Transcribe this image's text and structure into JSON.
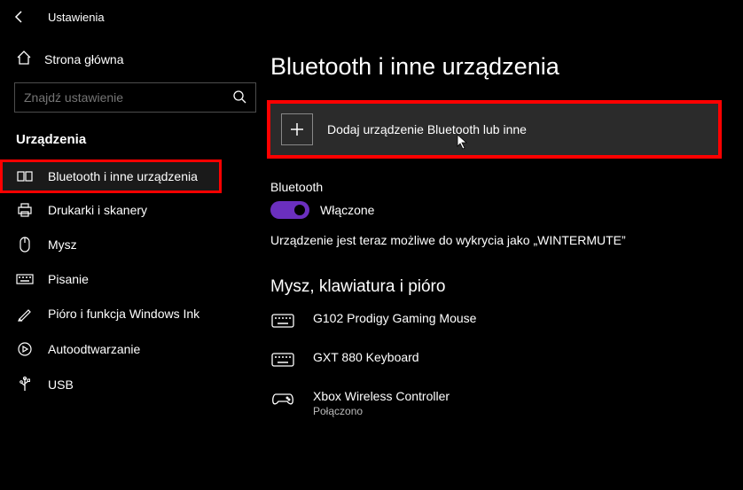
{
  "window": {
    "title": "Ustawienia"
  },
  "sidebar": {
    "home_label": "Strona główna",
    "search_placeholder": "Znajdź ustawienie",
    "section_label": "Urządzenia",
    "items": [
      {
        "label": "Bluetooth i inne urządzenia",
        "icon": "bluetooth-devices-icon"
      },
      {
        "label": "Drukarki i skanery",
        "icon": "printer-icon"
      },
      {
        "label": "Mysz",
        "icon": "mouse-icon"
      },
      {
        "label": "Pisanie",
        "icon": "keyboard-icon"
      },
      {
        "label": "Pióro i funkcja Windows Ink",
        "icon": "pen-icon"
      },
      {
        "label": "Autoodtwarzanie",
        "icon": "autoplay-icon"
      },
      {
        "label": "USB",
        "icon": "usb-icon"
      }
    ]
  },
  "main": {
    "title": "Bluetooth i inne urządzenia",
    "add_button_label": "Dodaj urządzenie Bluetooth lub inne",
    "bluetooth_label": "Bluetooth",
    "toggle_on_label": "Włączone",
    "status_line": "Urządzenie jest teraz możliwe do wykrycia jako „WINTERMUTE”",
    "devices_section_title": "Mysz, klawiatura i pióro",
    "devices": [
      {
        "name": "G102 Prodigy Gaming Mouse",
        "icon": "keyboard-device-icon",
        "status": ""
      },
      {
        "name": "GXT 880 Keyboard",
        "icon": "keyboard-device-icon",
        "status": ""
      },
      {
        "name": "Xbox Wireless Controller",
        "icon": "gamepad-icon",
        "status": "Połączono"
      }
    ]
  },
  "highlight": {
    "color": "#ff0000"
  },
  "accent": {
    "color": "#6b2fbf"
  }
}
